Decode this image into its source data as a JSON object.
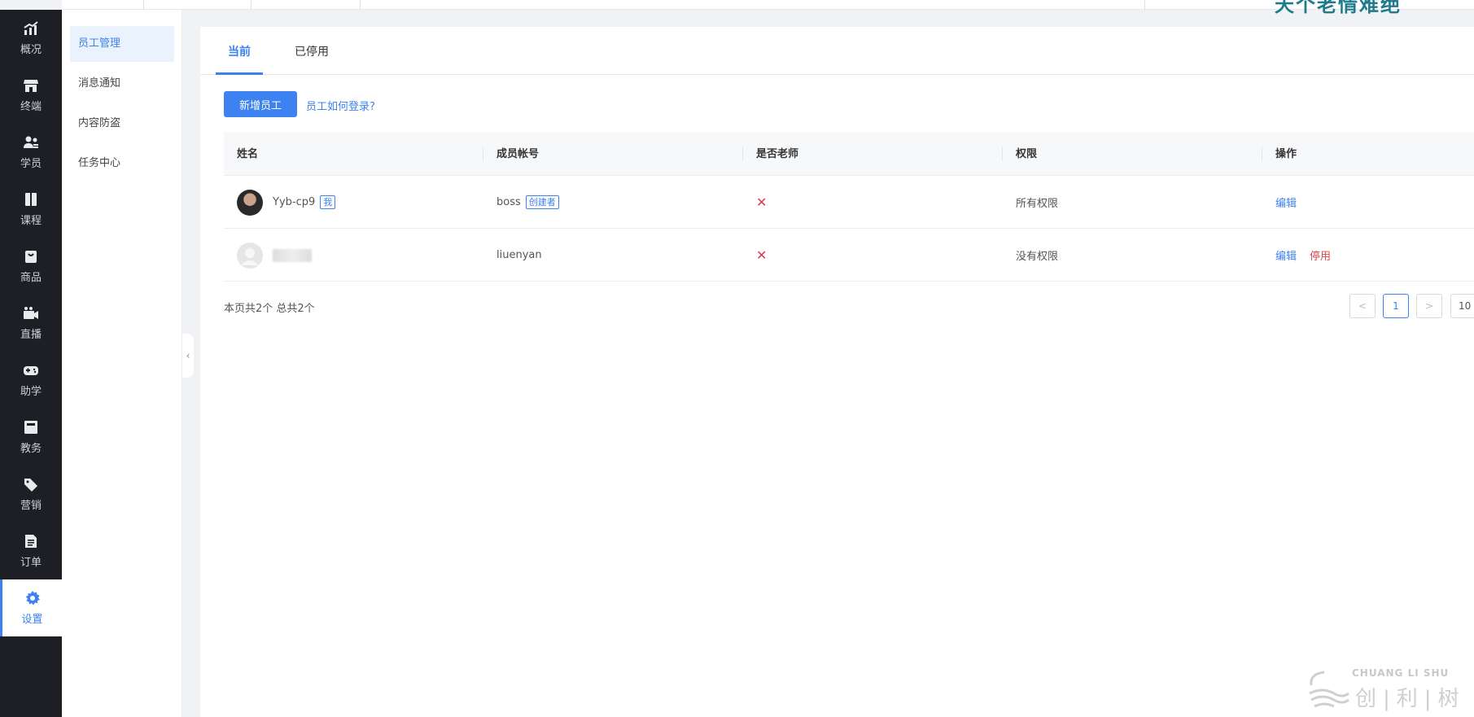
{
  "topbar": {
    "brand_text": "天个老情难绝"
  },
  "leftnav": {
    "items": [
      {
        "label": "概况",
        "icon": "chart-icon"
      },
      {
        "label": "终端",
        "icon": "store-icon"
      },
      {
        "label": "学员",
        "icon": "users-icon"
      },
      {
        "label": "课程",
        "icon": "book-icon"
      },
      {
        "label": "商品",
        "icon": "bag-icon"
      },
      {
        "label": "直播",
        "icon": "video-icon"
      },
      {
        "label": "助学",
        "icon": "gamepad-icon"
      },
      {
        "label": "教务",
        "icon": "notebook-icon"
      },
      {
        "label": "营销",
        "icon": "tag-icon"
      },
      {
        "label": "订单",
        "icon": "document-icon"
      },
      {
        "label": "设置",
        "icon": "gear-icon"
      }
    ],
    "active": "设置"
  },
  "subnav": {
    "items": [
      "员工管理",
      "消息通知",
      "内容防盗",
      "任务中心"
    ],
    "active": "员工管理"
  },
  "tabs": [
    "当前",
    "已停用"
  ],
  "toolbar": {
    "add_button": "新增员工",
    "help_link": "员工如何登录?"
  },
  "table": {
    "headers": [
      "姓名",
      "成员帐号",
      "是否老师",
      "权限",
      "操作"
    ],
    "rows": [
      {
        "name": "Yyb-cp9",
        "name_tag": "我",
        "account": "boss",
        "account_tag": "创建者",
        "is_teacher": "✕",
        "permission": "所有权限",
        "actions": [
          "编辑"
        ]
      },
      {
        "name": "",
        "name_tag": "",
        "account": "liuenyan",
        "account_tag": "",
        "is_teacher": "✕",
        "permission": "没有权限",
        "actions": [
          "编辑",
          "停用"
        ]
      }
    ]
  },
  "pagination": {
    "summary": "本页共2个 总共2个",
    "prev": "<",
    "current": "1",
    "next": ">",
    "page_size": "10"
  },
  "watermark": {
    "en": "CHUANG LI SHU",
    "cn": "创|利|树"
  },
  "colors": {
    "accent": "#3d82f0",
    "sidebar": "#1d1f24",
    "danger": "#e0474a",
    "cross": "#d23c56"
  }
}
